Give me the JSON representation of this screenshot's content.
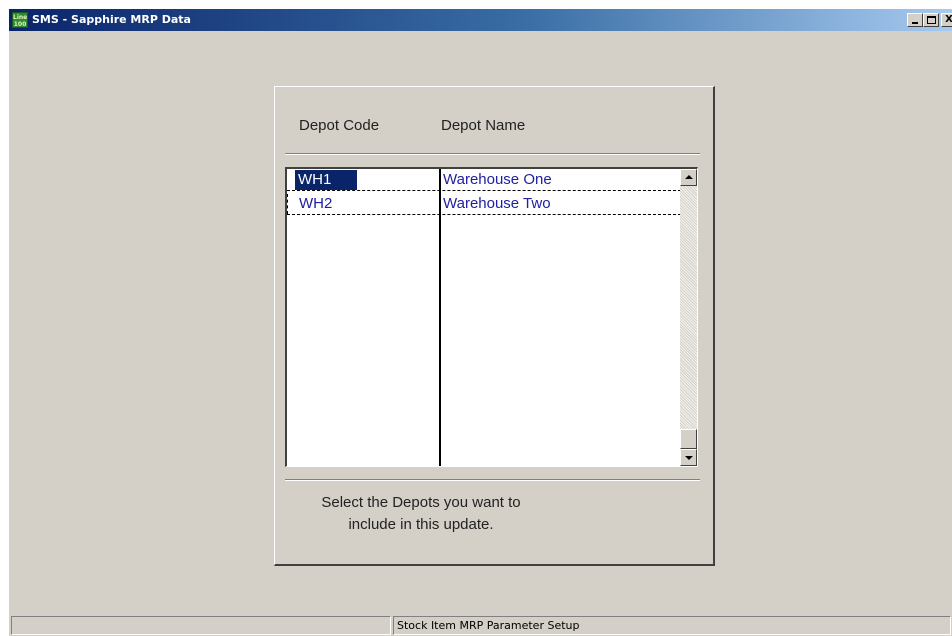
{
  "window": {
    "title": "SMS - Sapphire MRP Data",
    "icon_text": "Line 100",
    "controls": [
      "minimize",
      "maximize",
      "close"
    ],
    "close_glyph": "X"
  },
  "depot_list": {
    "headers": {
      "code": "Depot Code",
      "name": "Depot Name"
    },
    "rows": [
      {
        "code": "WH1",
        "name": "Warehouse One",
        "selected": true
      },
      {
        "code": "WH2",
        "name": "Warehouse Two",
        "selected": false
      }
    ]
  },
  "instruction": {
    "line1": "Select the Depots you want to",
    "line2": "include in this update."
  },
  "statusbar": {
    "pane1": "",
    "pane2": "Stock Item MRP Parameter Setup"
  },
  "colors": {
    "titlebar": "#0a246a",
    "selection": "#0a246a",
    "list_text": "#2020a0",
    "face": "#d4d0c8"
  }
}
